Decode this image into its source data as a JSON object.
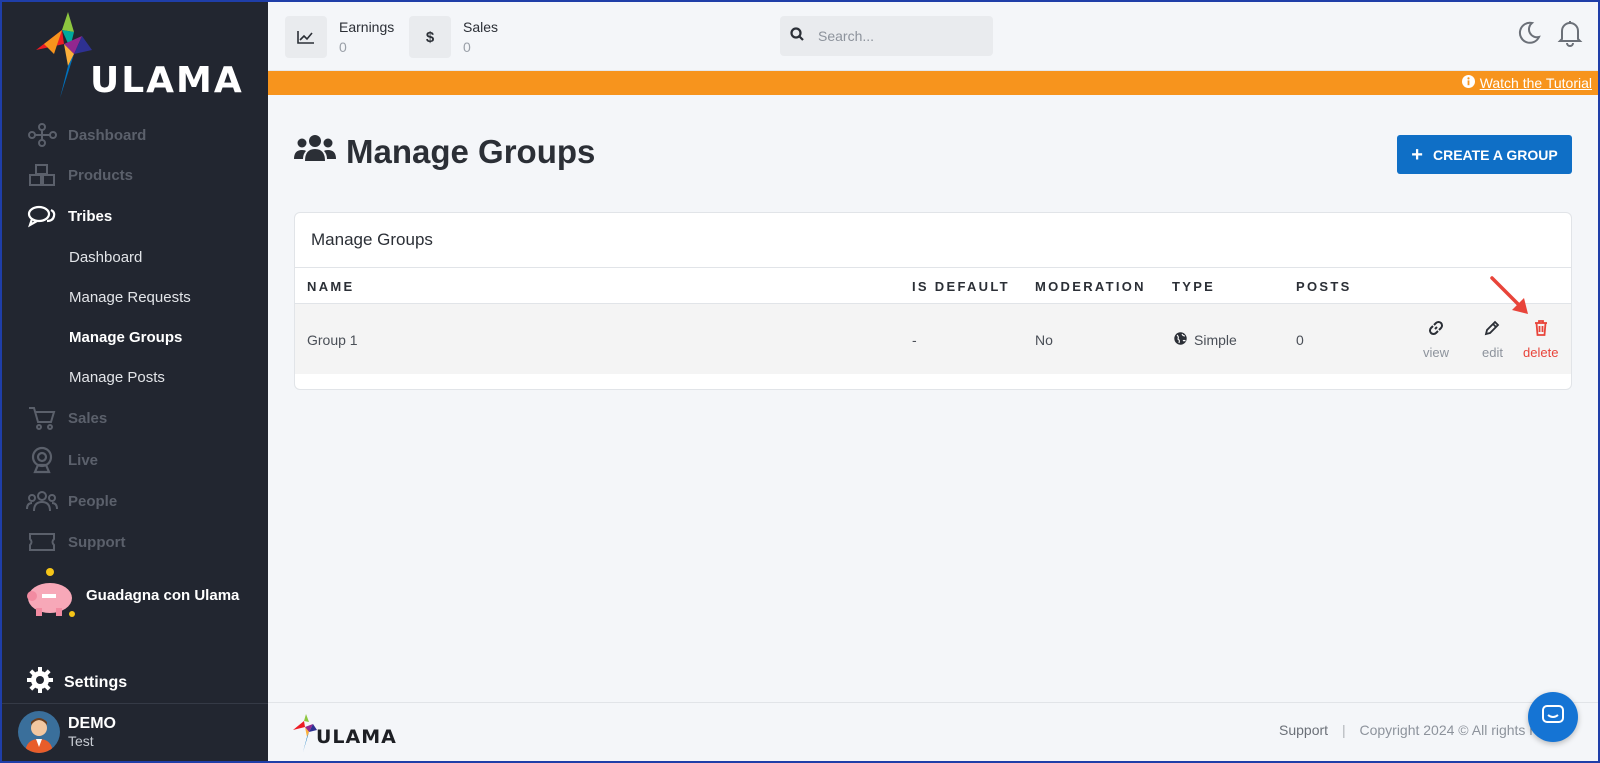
{
  "sidebar": {
    "logo_text": "ULAMA",
    "nav": [
      {
        "label": "Dashboard",
        "icon": "network-icon"
      },
      {
        "label": "Products",
        "icon": "cubes-icon"
      },
      {
        "label": "Tribes",
        "icon": "chat-bubbles-icon"
      },
      {
        "label": "Sales",
        "icon": "cart-icon"
      },
      {
        "label": "Live",
        "icon": "webcam-icon"
      },
      {
        "label": "People",
        "icon": "people-icon"
      },
      {
        "label": "Support",
        "icon": "ticket-icon"
      }
    ],
    "tribes_sub": [
      {
        "label": "Dashboard"
      },
      {
        "label": "Manage Requests"
      },
      {
        "label": "Manage Groups"
      },
      {
        "label": "Manage Posts"
      }
    ],
    "promo_label": "Guadagna con Ulama",
    "settings_label": "Settings",
    "user": {
      "name": "DEMO",
      "role": "Test"
    }
  },
  "topbar": {
    "earnings": {
      "label": "Earnings",
      "value": "0"
    },
    "sales": {
      "label": "Sales",
      "value": "0",
      "icon_glyph": "$"
    },
    "search_placeholder": "Search..."
  },
  "banner": {
    "link_text": "Watch the Tutorial"
  },
  "page": {
    "title": "Manage Groups",
    "create_button": "CREATE A GROUP",
    "card_title": "Manage Groups"
  },
  "table": {
    "headers": [
      "NAME",
      "IS DEFAULT",
      "MODERATION",
      "TYPE",
      "POSTS"
    ],
    "rows": [
      {
        "name": "Group 1",
        "is_default": "-",
        "moderation": "No",
        "type": "Simple",
        "posts": "0"
      }
    ],
    "actions": {
      "view": "view",
      "edit": "edit",
      "delete": "delete"
    }
  },
  "footer": {
    "logo_text": "ULAMA",
    "support": "Support",
    "separator": "|",
    "copyright": "Copyright 2024 © All rights re..."
  },
  "colors": {
    "sidebar_bg": "#222630",
    "accent_orange": "#f7941d",
    "primary_blue": "#0f6fc6",
    "delete_red": "#e8443a"
  }
}
